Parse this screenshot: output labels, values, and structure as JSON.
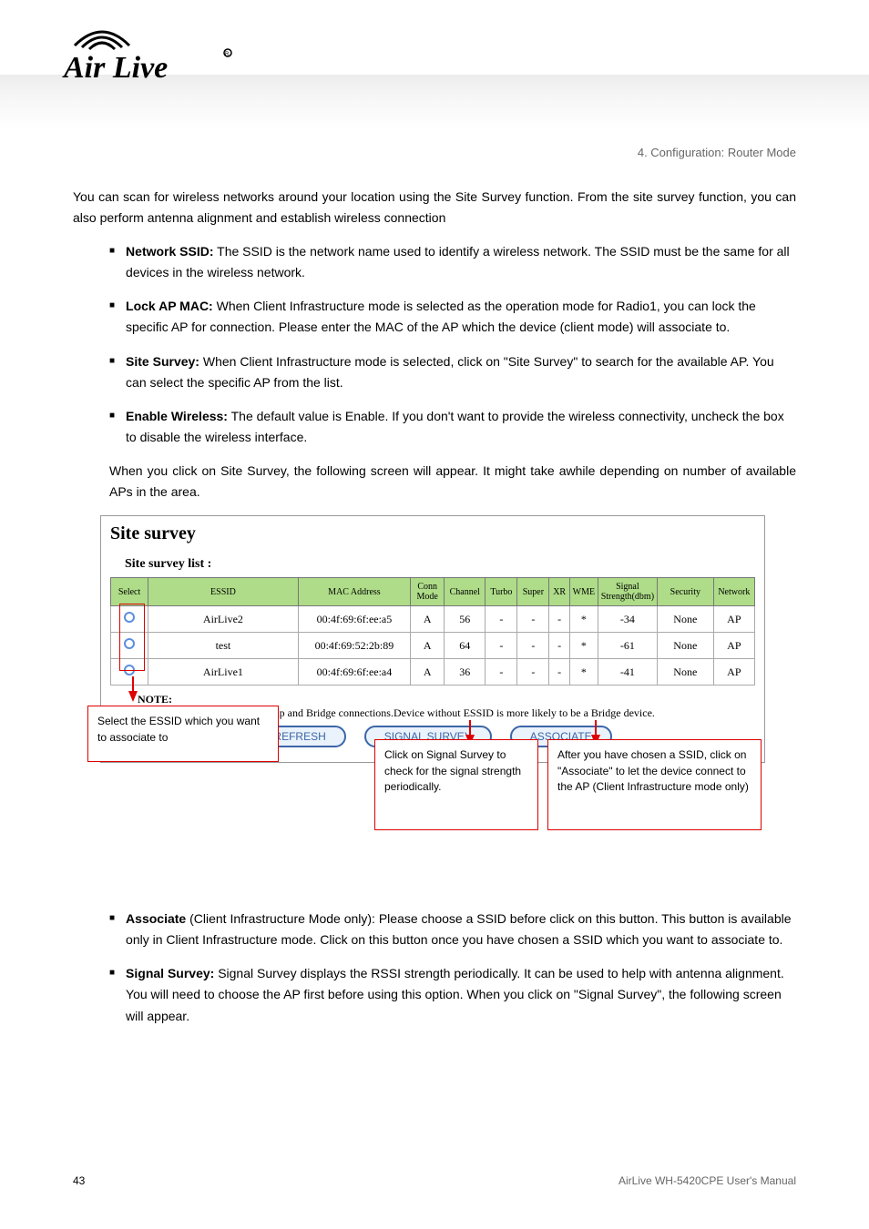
{
  "brand": "Air Live",
  "chapter_label": "4. Configuration: Router Mode",
  "intro": "You can scan for wireless networks around your location using the Site Survey function. From the site survey function, you can also perform antenna alignment and establish wireless connection",
  "bridge_para": "When you click on Site Survey, the following screen will appear. It might take awhile depending on number of available APs in the area.",
  "bullets_top": [
    {
      "b": "Network SSID:",
      "t": " The SSID is the network name used to identify a wireless network.   The SSID must be the same for all devices in the wireless network."
    },
    {
      "b": "Lock AP MAC:",
      "t": "  When Client Infrastructure mode is selected as the operation mode for Radio1, you can lock the specific AP for connection. Please enter the MAC of the AP which the device (client mode) will associate to."
    },
    {
      "b": "Site Survey:",
      "t": "  When Client Infrastructure mode is selected, click on \"Site Survey\" to search for the available AP. You can select the specific AP from the list."
    },
    {
      "b": "Enable Wireless:",
      "t": " The default value is Enable. If you don't want to provide the wireless connectivity, uncheck the box to disable the wireless interface."
    }
  ],
  "bullets_bottom": [
    {
      "b": "Associate",
      "t": " (Client Infrastructure Mode only): Please choose a SSID before click on this button. This button is available only in Client Infrastructure mode. Click on this button once you have chosen a SSID which you want to associate to."
    },
    {
      "b": "Signal Survey:",
      "t": " Signal Survey displays the RSSI strength periodically. It can be used to help with antenna alignment. You will need to choose the AP first before using this option. When you click on \"Signal Survey\", the following screen will appear."
    }
  ],
  "ss": {
    "title": "Site survey",
    "list_label": "Site survey list :",
    "headers": [
      "Select",
      "ESSID",
      "MAC Address",
      "Conn Mode",
      "Channel",
      "Turbo",
      "Super",
      "XR",
      "WME",
      "Signal Strength(dbm)",
      "Security",
      "Network"
    ],
    "rows": [
      {
        "essid": "AirLive2",
        "mac": "00:4f:69:6f:ee:a5",
        "cm": "A",
        "ch": "56",
        "turbo": "-",
        "super": "-",
        "xr": "-",
        "wme": "*",
        "sig": "-34",
        "sec": "None",
        "net": "AP"
      },
      {
        "essid": "test",
        "mac": "00:4f:69:52:2b:89",
        "cm": "A",
        "ch": "64",
        "turbo": "-",
        "super": "-",
        "xr": "-",
        "wme": "*",
        "sig": "-61",
        "sec": "None",
        "net": "AP"
      },
      {
        "essid": "AirLive1",
        "mac": "00:4f:69:6f:ee:a4",
        "cm": "A",
        "ch": "36",
        "turbo": "-",
        "super": "-",
        "xr": "-",
        "wme": "*",
        "sig": "-41",
        "sec": "None",
        "net": "AP"
      }
    ],
    "note_label": "NOTE:",
    "note_text": " The sitesurvey will show both Ap and Bridge connections.Device without ESSID is more likely to be a Bridge device.",
    "btn_refresh": "REFRESH",
    "btn_signal": "SIGNAL SURVEY",
    "btn_associate": "ASSOCIATE",
    "callout1": "Select the ESSID which you want to associate to",
    "callout2": "Click on Signal Survey to check for the signal strength periodically.",
    "callout3": "After you have chosen a SSID, click on \"Associate\" to let the device connect to the AP (Client Infrastructure mode only)"
  },
  "footer_page": "43",
  "footer_right": "AirLive WH-5420CPE User's Manual"
}
